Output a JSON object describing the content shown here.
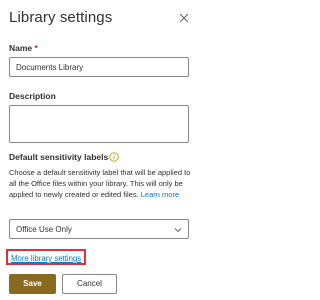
{
  "panel": {
    "title": "Library settings",
    "close_icon": "close-icon"
  },
  "name_field": {
    "label": "Name",
    "required_marker": "*",
    "value": "Documents Library"
  },
  "description_field": {
    "label": "Description",
    "value": ""
  },
  "sensitivity": {
    "label": "Default sensitivity labels",
    "info_icon": "info-icon",
    "description": "Choose a default sensitivity label that will be applied to all the Office files within your library. This will only be applied to newly created or edited files.",
    "learn_more": "Learn more",
    "selected_value": "Office Use Only",
    "chevron_icon": "chevron-down-icon"
  },
  "links": {
    "more_settings": "More library settings"
  },
  "buttons": {
    "save": "Save",
    "cancel": "Cancel"
  },
  "colors": {
    "primary_button": "#8a6a20",
    "link": "#0078d4",
    "highlight_border": "#e0323e",
    "required": "#a4262c"
  }
}
